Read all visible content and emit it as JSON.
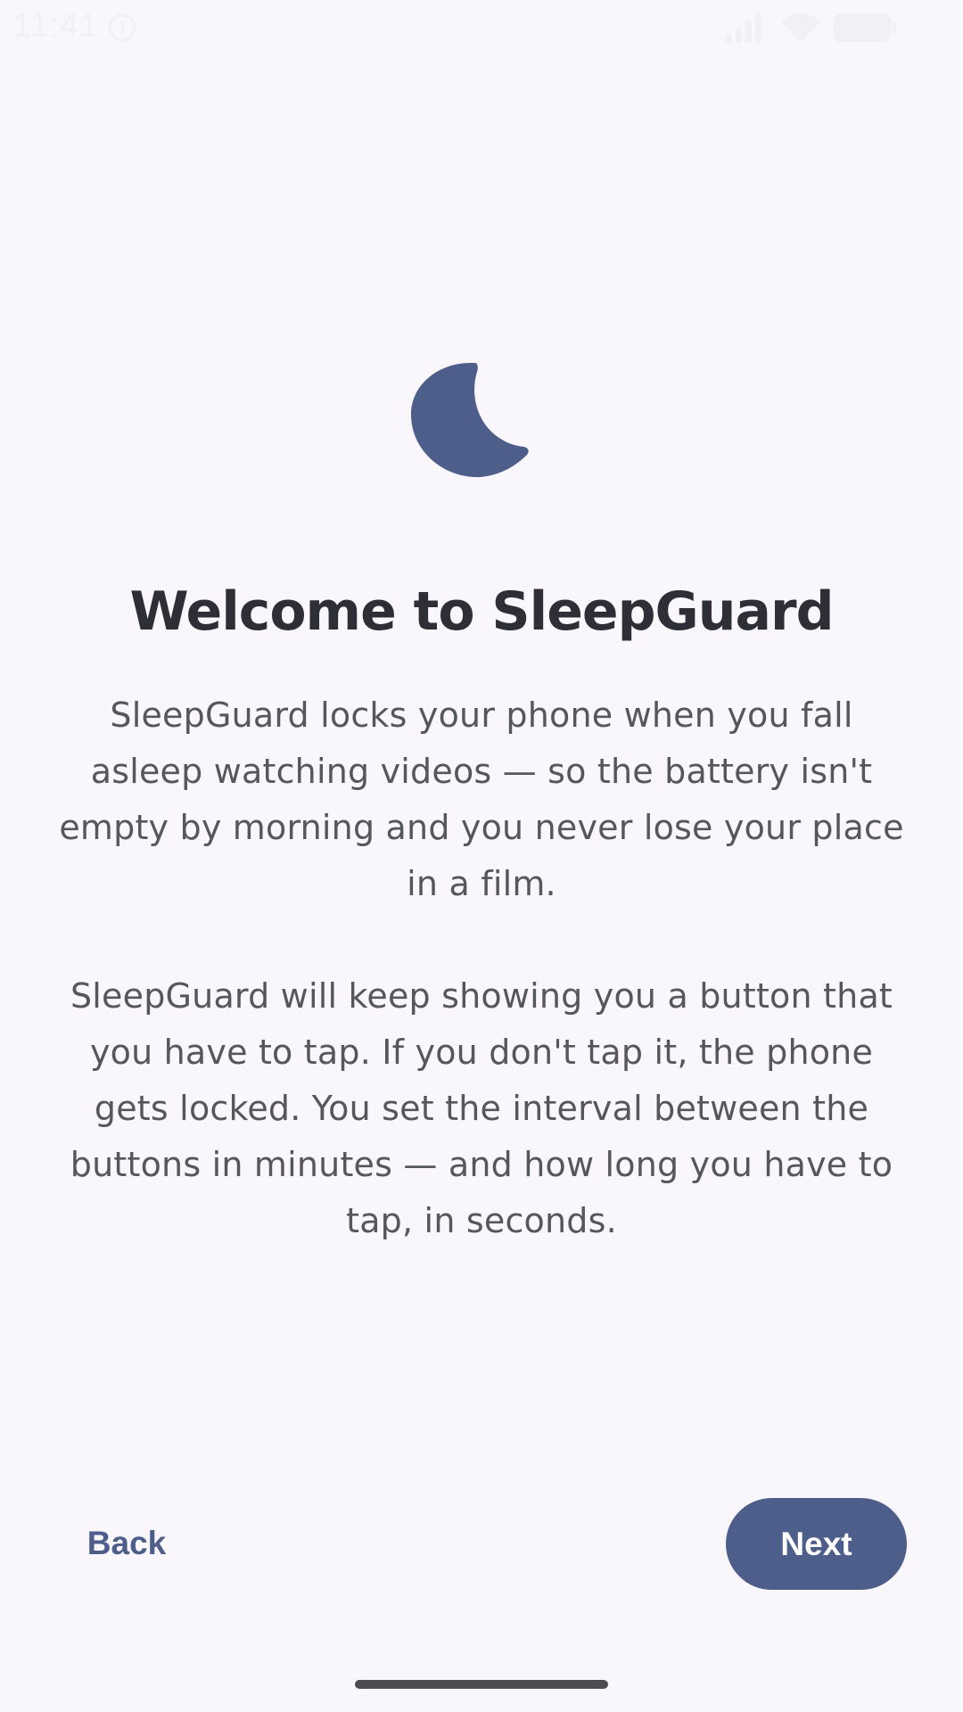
{
  "status_bar": {
    "time": "11:41",
    "icons": [
      "info-icon",
      "signal-icon",
      "wifi-icon",
      "battery-icon"
    ]
  },
  "onboarding": {
    "icon": "moon-icon",
    "title": "Welcome to SleepGuard",
    "paragraph_1": "SleepGuard locks your phone when you fall asleep watching videos — so the battery isn't empty by morning and you never lose your place in a film.",
    "paragraph_2": "SleepGuard will keep showing you a button that you have to tap. If you don't tap it, the phone gets locked. You set the interval between the buttons in minutes — and how long you have to tap, in seconds."
  },
  "navigation": {
    "back_label": "Back",
    "next_label": "Next"
  },
  "colors": {
    "background": "#F9F7FC",
    "accent": "#4E5E8A",
    "title_text": "#2E2F36",
    "body_text": "#56575D"
  }
}
